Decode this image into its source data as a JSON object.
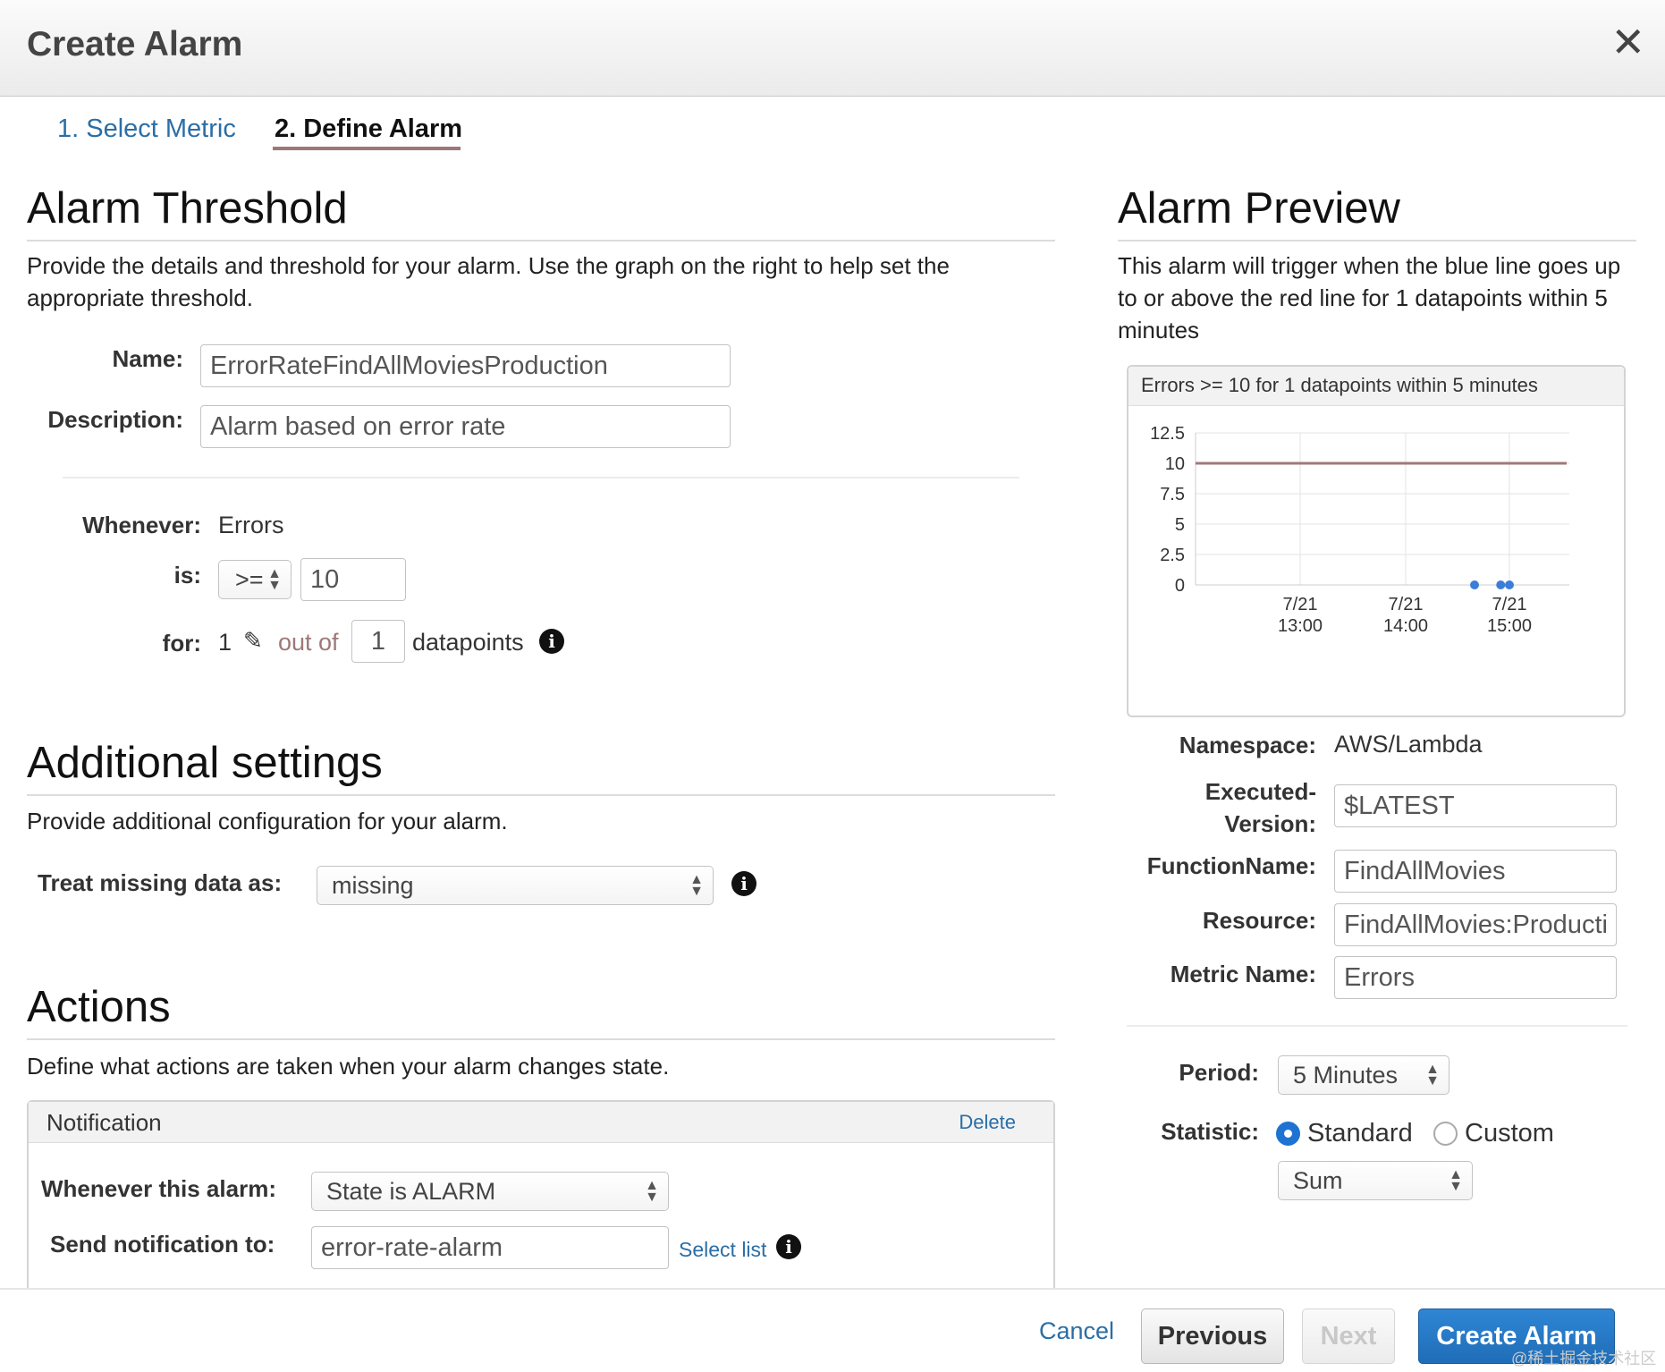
{
  "dialog": {
    "title": "Create Alarm",
    "close_glyph": "✕"
  },
  "tabs": [
    {
      "label": "1. Select Metric",
      "active": false
    },
    {
      "label": "2. Define Alarm",
      "active": true
    }
  ],
  "threshold": {
    "title": "Alarm Threshold",
    "description": "Provide the details and threshold for your alarm. Use the graph on the right to help set the appropriate threshold.",
    "name_label": "Name:",
    "name_value": "ErrorRateFindAllMoviesProduction",
    "desc_label": "Description:",
    "desc_value": "Alarm based on error rate",
    "whenever_label": "Whenever:",
    "whenever_value": "Errors",
    "is_label": "is:",
    "operator": ">=",
    "threshold_value": "10",
    "for_label": "for:",
    "for_count": "1",
    "out_of_text": "out of",
    "out_of_value": "1",
    "datapoints_text": "datapoints"
  },
  "additional": {
    "title": "Additional settings",
    "description": "Provide additional configuration for your alarm.",
    "missing_label": "Treat missing data as:",
    "missing_value": "missing"
  },
  "actions": {
    "title": "Actions",
    "description": "Define what actions are taken when your alarm changes state.",
    "panel_title": "Notification",
    "delete_label": "Delete",
    "whenever_label": "Whenever this alarm:",
    "whenever_value": "State is ALARM",
    "send_label": "Send notification to:",
    "send_value": "error-rate-alarm",
    "select_list_label": "Select list"
  },
  "preview": {
    "title": "Alarm Preview",
    "description": "This alarm will trigger when the blue line goes up to or above the red line for 1 datapoints within 5 minutes",
    "namespace_label": "Namespace:",
    "namespace_value": "AWS/Lambda",
    "executed_label_1": "Executed-",
    "executed_label_2": "Version:",
    "executed_value": "$LATEST",
    "function_label": "FunctionName:",
    "function_value": "FindAllMovies",
    "resource_label": "Resource:",
    "resource_value": "FindAllMovies:Producti",
    "metric_label": "Metric Name:",
    "metric_value": "Errors",
    "period_label": "Period:",
    "period_value": "5 Minutes",
    "statistic_label": "Statistic:",
    "standard_label": "Standard",
    "custom_label": "Custom",
    "statistic_value": "Sum"
  },
  "chart_data": {
    "type": "line",
    "title": "Errors >= 10 for 1 datapoints within 5 minutes",
    "y_ticks": [
      "12.5",
      "10",
      "7.5",
      "5",
      "2.5",
      "0"
    ],
    "ylim": [
      0,
      12.5
    ],
    "x_ticks": [
      {
        "line1": "7/21",
        "line2": "13:00"
      },
      {
        "line1": "7/21",
        "line2": "14:00"
      },
      {
        "line1": "7/21",
        "line2": "15:00"
      }
    ],
    "threshold": {
      "value": 10,
      "color": "#a07878"
    },
    "series": [
      {
        "color": "#3b7dd8",
        "x": [
          "7/21 14:40",
          "7/21 14:55",
          "7/21 15:00"
        ],
        "values": [
          0,
          0,
          0
        ]
      }
    ],
    "grid": true
  },
  "footer": {
    "cancel_label": "Cancel",
    "previous_label": "Previous",
    "next_label": "Next",
    "create_label": "Create Alarm",
    "watermark": "@稀土掘金技术社区"
  }
}
